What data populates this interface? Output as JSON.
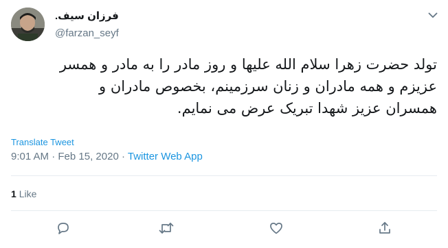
{
  "author": {
    "name": "فرزان سیف.",
    "handle": "@farzan_seyf"
  },
  "tweet": {
    "text": "تولد حضرت زهرا سلام الله علیها و روز مادر را به مادر و همسر\nعزیزم و همه مادران و زنان سرزمینم، بخصوص مادران و\nهمسران عزیز شهدا تبریک عرض می نمایم.",
    "translate_label": "Translate Tweet",
    "time": "9:01 AM",
    "separator": " · ",
    "date": "Feb 15, 2020",
    "source": "Twitter Web App"
  },
  "stats": {
    "likes_count": "1",
    "likes_label": "Like"
  },
  "icons": {
    "caret": "chevron-down-icon",
    "reply": "reply-icon",
    "retweet": "retweet-icon",
    "like": "heart-icon",
    "share": "share-icon"
  },
  "colors": {
    "link": "#1b95e0",
    "secondary_text": "#657786",
    "primary_text": "#14171a",
    "divider": "#e6ecf0"
  }
}
